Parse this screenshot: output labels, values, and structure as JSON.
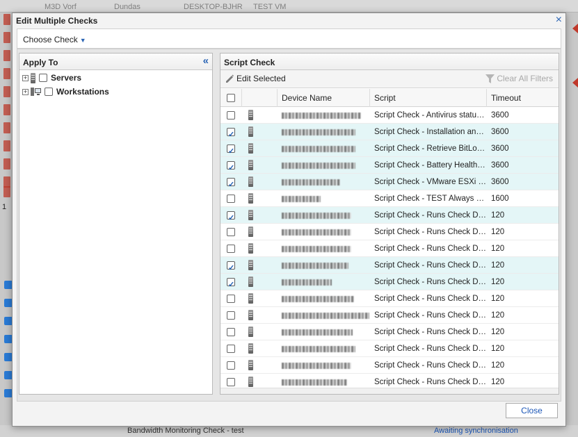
{
  "background": {
    "top_strip": [
      "M3D Vorf",
      "Dundas",
      "DESKTOP-BJHR",
      "TEST VM"
    ],
    "page_number": "1",
    "bottom_check_name": "Bandwidth Monitoring Check - test",
    "bottom_status": "Awaiting synchronisation"
  },
  "modal": {
    "title": "Edit Multiple Checks",
    "close_label": "×",
    "choose_check_label": "Choose Check",
    "footer_close_label": "Close"
  },
  "apply_to": {
    "title": "Apply To",
    "items": [
      {
        "label": "Servers",
        "checked": false
      },
      {
        "label": "Workstations",
        "checked": false
      }
    ]
  },
  "script_check": {
    "title": "Script Check",
    "edit_selected_label": "Edit Selected",
    "clear_filters_label": "Clear All Filters",
    "columns": [
      "Device Name",
      "Script",
      "Timeout"
    ],
    "rows": [
      {
        "checked": false,
        "script": "Script Check - Antivirus status…",
        "timeout": "3600"
      },
      {
        "checked": true,
        "script": "Script Check - Installation and…",
        "timeout": "3600"
      },
      {
        "checked": true,
        "script": "Script Check - Retrieve BitLoc…",
        "timeout": "3600"
      },
      {
        "checked": true,
        "script": "Script Check - Battery Health …",
        "timeout": "3600"
      },
      {
        "checked": true,
        "script": "Script Check - VMware ESXi …",
        "timeout": "3600"
      },
      {
        "checked": false,
        "script": "Script Check - TEST Always P…",
        "timeout": "1600"
      },
      {
        "checked": true,
        "script": "Script Check - Runs Check Disk",
        "timeout": "120"
      },
      {
        "checked": false,
        "script": "Script Check - Runs Check Disk",
        "timeout": "120"
      },
      {
        "checked": false,
        "script": "Script Check - Runs Check Disk",
        "timeout": "120"
      },
      {
        "checked": true,
        "script": "Script Check - Runs Check Disk",
        "timeout": "120"
      },
      {
        "checked": true,
        "script": "Script Check - Runs Check Disk",
        "timeout": "120"
      },
      {
        "checked": false,
        "script": "Script Check - Runs Check Disk",
        "timeout": "120"
      },
      {
        "checked": false,
        "script": "Script Check - Runs Check Disk",
        "timeout": "120"
      },
      {
        "checked": false,
        "script": "Script Check - Runs Check Disk",
        "timeout": "120"
      },
      {
        "checked": false,
        "script": "Script Check - Runs Check Disk",
        "timeout": "120"
      },
      {
        "checked": false,
        "script": "Script Check - Runs Check Disk",
        "timeout": "120"
      },
      {
        "checked": false,
        "script": "Script Check - Runs Check Disk",
        "timeout": "120"
      }
    ]
  },
  "colors": {
    "accent": "#2a64b4",
    "selected_row": "#e4f6f7"
  }
}
